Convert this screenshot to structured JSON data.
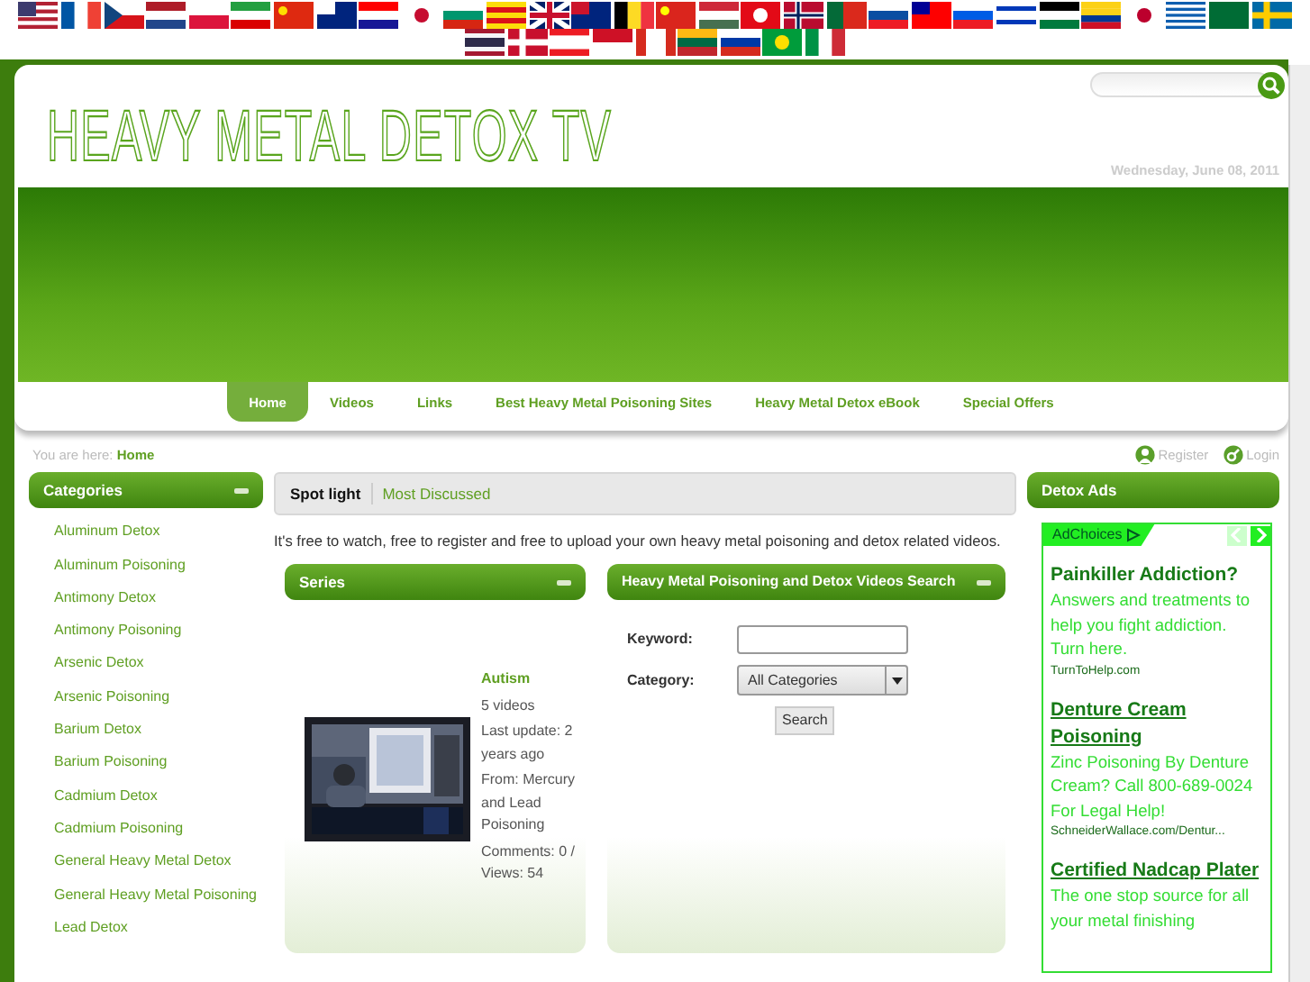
{
  "header": {
    "title": "HEAVY METAL DETOX TV",
    "date": "Wednesday, June 08, 2011"
  },
  "nav": [
    {
      "label": "Home",
      "selected": true
    },
    {
      "label": "Videos",
      "selected": false
    },
    {
      "label": "Links",
      "selected": false
    },
    {
      "label": "Best Heavy Metal Poisoning Sites",
      "selected": false
    },
    {
      "label": "Heavy Metal Detox eBook",
      "selected": false
    },
    {
      "label": "Special Offers",
      "selected": false
    }
  ],
  "breadcrumb": {
    "label": "You are here:",
    "current": "Home"
  },
  "user_links": [
    "Register",
    "Login"
  ],
  "categories": {
    "title": "Categories",
    "items": [
      "Aluminum Detox",
      "Aluminum Poisoning",
      "Antimony Detox",
      "Antimony Poisoning",
      "Arsenic Detox",
      "Arsenic Poisoning",
      "Barium Detox",
      "Barium Poisoning",
      "Cadmium Detox",
      "Cadmium Poisoning",
      "General Heavy Metal Detox",
      "General Heavy Metal Poisoning",
      "Lead Detox"
    ]
  },
  "content_tabs": [
    {
      "label": "Spot light",
      "selected": true
    },
    {
      "label": "Most Discussed",
      "selected": false
    }
  ],
  "intro": "It's free to watch, free to register and free to upload your own heavy metal poisoning and detox related videos.",
  "series": {
    "title": "Series",
    "item": {
      "name": "Autism",
      "count": "5 videos",
      "updated": "Last update: 2 years ago",
      "from": "From: Mercury and Lead Poisoning",
      "stats": "Comments: 0 / Views: 54"
    }
  },
  "search_panel": {
    "title": "Heavy Metal Poisoning and Detox Videos Search",
    "keyword_label": "Keyword:",
    "category_label": "Category:",
    "category_value": "All Categories",
    "button": "Search"
  },
  "ads": {
    "title": "Detox Ads",
    "adchoices": "AdChoices",
    "items": [
      {
        "headline": "Painkiller Addiction?",
        "underlined": false,
        "text": "Answers and treatments to help you fight addiction. Turn here.",
        "url": "TurnToHelp.com"
      },
      {
        "headline": "Denture Cream Poisoning",
        "underlined": true,
        "text": "Zinc Poisoning By Denture Cream? Call 800-689-0024 For Legal Help!",
        "url": "SchneiderWallace.com/Dentur..."
      },
      {
        "headline": "Certified Nadcap Plater",
        "underlined": true,
        "text": "The one stop source for all your metal finishing"
      }
    ]
  }
}
